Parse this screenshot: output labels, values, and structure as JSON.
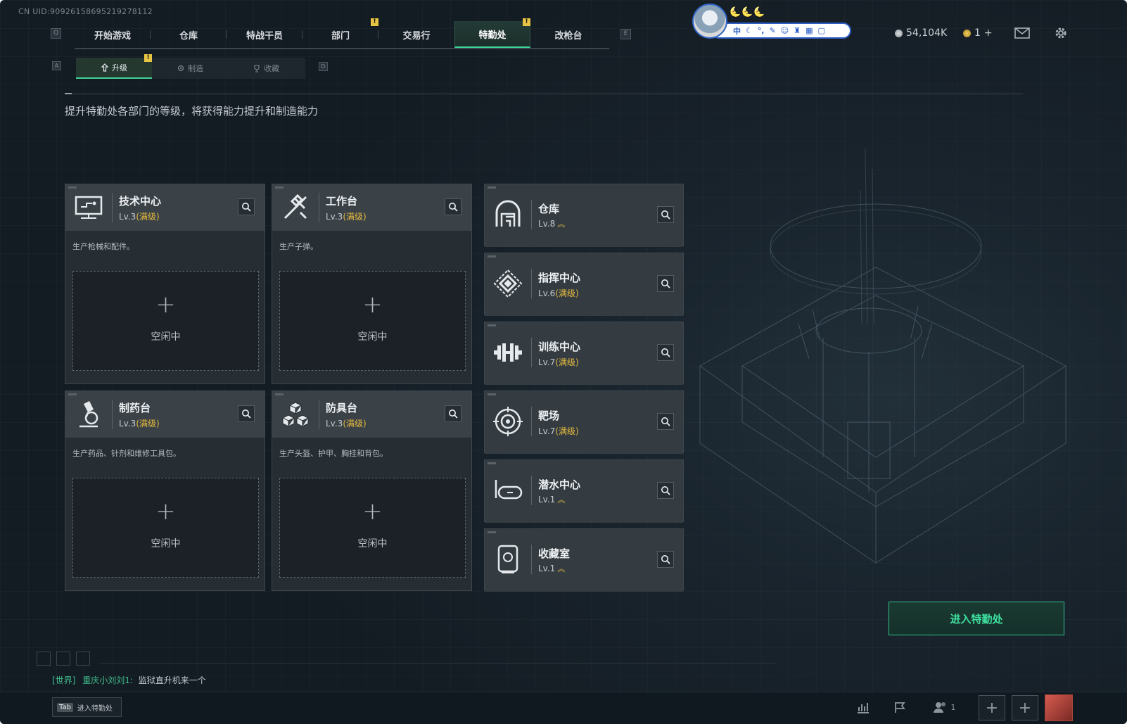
{
  "uid": "CN UID:9092615869521927811​2",
  "nav": {
    "left_key": "Q",
    "right_key": "E",
    "tabs": [
      "开始游戏",
      "仓库",
      "特战干员",
      "部门",
      "交易行",
      "特勤处",
      "改枪台"
    ],
    "active": "特勤处"
  },
  "subnav": {
    "left_key": "A",
    "right_key": "D",
    "tabs": [
      "升级",
      "制造",
      "收藏"
    ]
  },
  "badge_mark": "!",
  "description": "提升特勤处各部门的等级，将获得能力提升和制造能力",
  "ime": {
    "label": "中",
    "moons": "🌜🌜🌜"
  },
  "resources": {
    "currency": "54,104K",
    "tokens": "1",
    "tokens_add": "+"
  },
  "workstations": [
    {
      "name": "技术中心",
      "level": "Lv.3",
      "status": "(满级)",
      "desc": "生产枪械和配件。",
      "slot_label": "空闲中",
      "icon": "monitor-icon"
    },
    {
      "name": "工作台",
      "level": "Lv.3",
      "status": "(满级)",
      "desc": "生产子弹。",
      "slot_label": "空闲中",
      "icon": "tools-icon"
    },
    {
      "name": "制药台",
      "level": "Lv.3",
      "status": "(满级)",
      "desc": "生产药品、针剂和维修工具包。",
      "slot_label": "空闲中",
      "icon": "microscope-icon"
    },
    {
      "name": "防具台",
      "level": "Lv.3",
      "status": "(满级)",
      "desc": "生产头盔、护甲、胸挂和背包。",
      "slot_label": "空闲中",
      "icon": "cubes-icon"
    }
  ],
  "facilities": [
    {
      "name": "仓库",
      "level": "Lv.8",
      "status": "",
      "upgradable": true,
      "icon": "storage-icon"
    },
    {
      "name": "指挥中心",
      "level": "Lv.6",
      "status": "(满级)",
      "upgradable": false,
      "icon": "command-icon"
    },
    {
      "name": "训练中心",
      "level": "Lv.7",
      "status": "(满级)",
      "upgradable": false,
      "icon": "dumbbell-icon"
    },
    {
      "name": "靶场",
      "level": "Lv.7",
      "status": "(满级)",
      "upgradable": false,
      "icon": "target-icon"
    },
    {
      "name": "潜水中心",
      "level": "Lv.1",
      "status": "",
      "upgradable": true,
      "icon": "diving-mask-icon"
    },
    {
      "name": "收藏室",
      "level": "Lv.1",
      "status": "",
      "upgradable": true,
      "icon": "collection-icon"
    }
  ],
  "enter_button": "进入特勤处",
  "chat": {
    "channel": "[世界]",
    "user": "重庆小刘刘1:",
    "message": "监狱直升机来一个"
  },
  "bottom": {
    "tab_key": "Tab",
    "tab_label": "进入特勤处",
    "friends_count": "1"
  }
}
